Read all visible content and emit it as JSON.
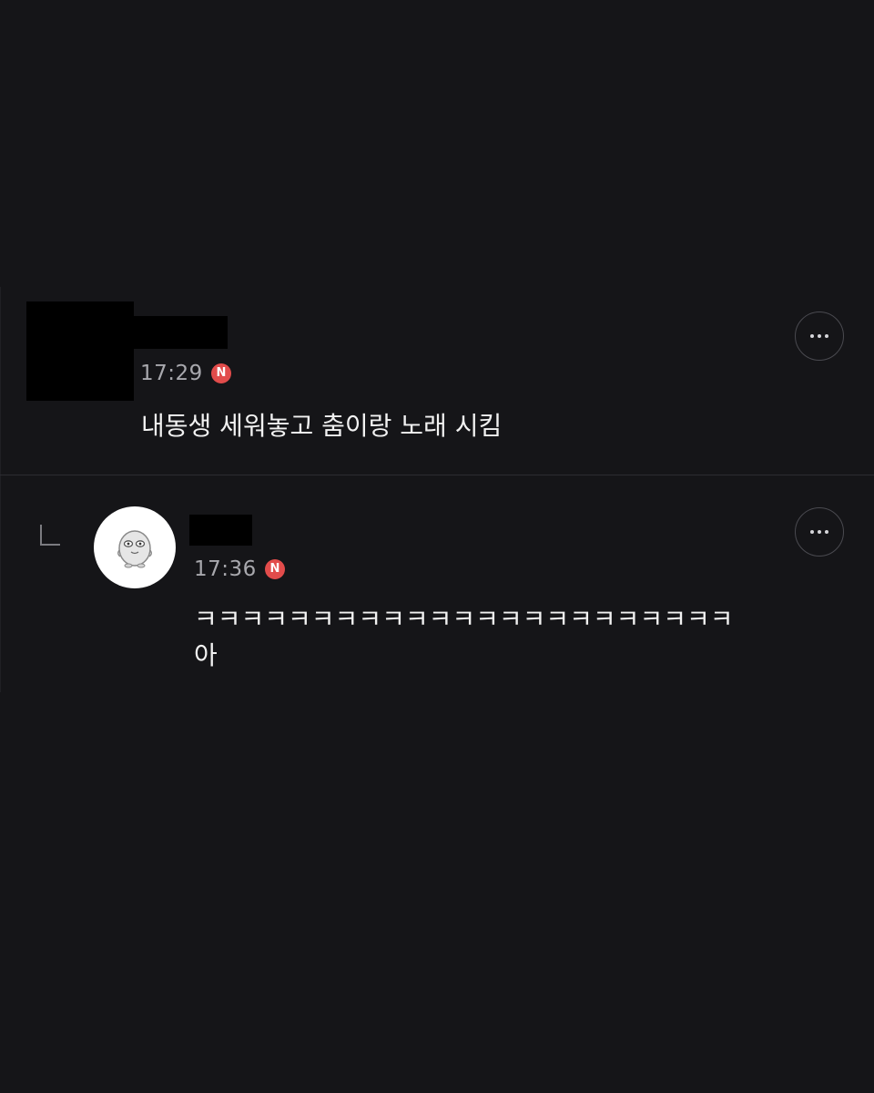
{
  "comments": [
    {
      "author_redacted": true,
      "time": "17:29",
      "badge": "N",
      "text": "내동생 세워놓고 춤이랑 노래 시킴",
      "more_icon": "ellipsis-icon"
    },
    {
      "is_reply": true,
      "author_redacted": true,
      "time": "17:36",
      "badge": "N",
      "text": "ㅋㅋㅋㅋㅋㅋㅋㅋㅋㅋㅋㅋㅋㅋㅋㅋㅋㅋㅋㅋㅋㅋㅋㅋㅋㅋㅋㅋㅋㅋㅋㅋㅋㅋㅋㅋㅋㅋㅋㅋㅋㅋㅋㅋㅋ아",
      "line1": "ㅋㅋㅋㅋㅋㅋㅋㅋㅋㅋㅋㅋㅋㅋㅋㅋㅋㅋㅋㅋㅋㅋㅋ",
      "line2": "아",
      "avatar_icon": "character-avatar-icon",
      "reply_icon": "reply-arrow-icon",
      "more_icon": "ellipsis-icon"
    }
  ],
  "colors": {
    "background": "#151518",
    "badge": "#e24c4b",
    "text": "#f2f2f2",
    "timestamp": "#a8a8ad"
  }
}
